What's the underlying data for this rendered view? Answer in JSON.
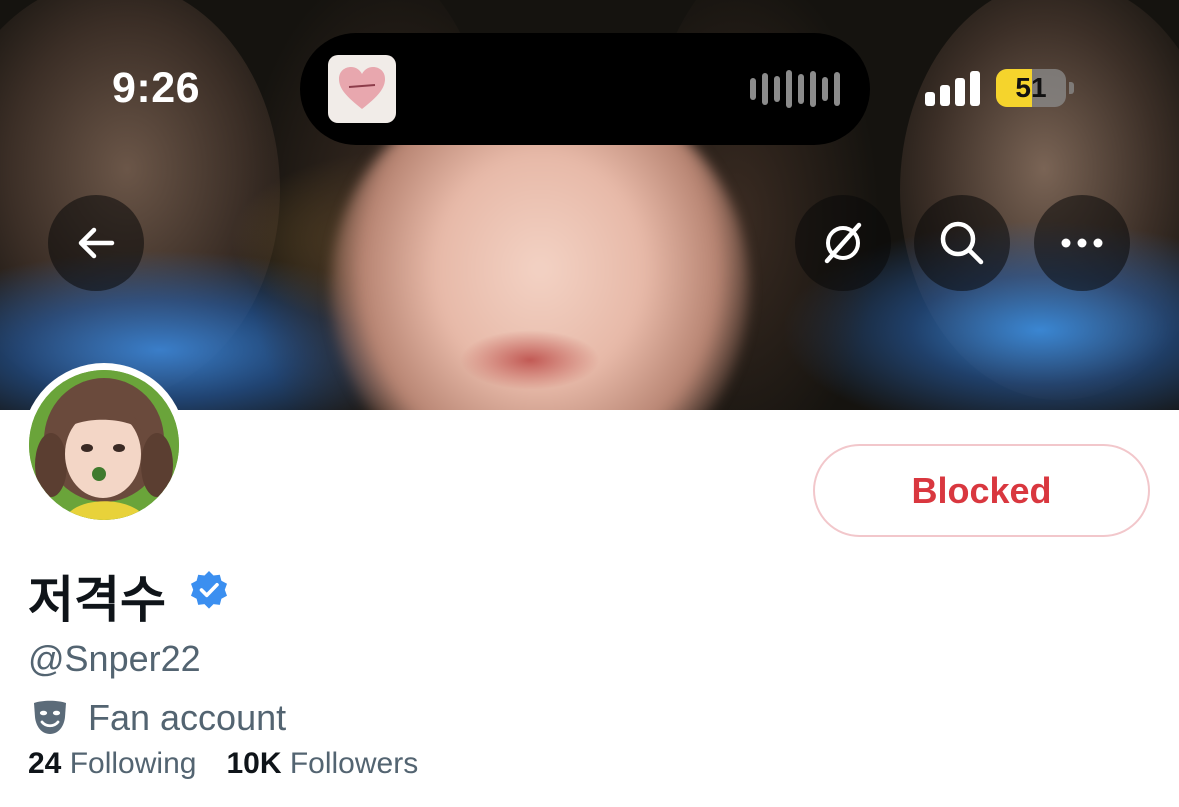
{
  "status_bar": {
    "time": "9:26",
    "battery_level": "51",
    "battery_fraction": 0.51,
    "signal_bars": 4,
    "accent_battery": "#f5d42c"
  },
  "dynamic_island": {
    "album_art": "heart-album-art",
    "wave_icon": "audio-waveform-icon"
  },
  "header_buttons": {
    "back": "arrow-left-icon",
    "grok": "grok-slash-circle-icon",
    "search": "search-icon",
    "more": "more-horizontal-icon"
  },
  "profile": {
    "display_name": "저격수",
    "verified": true,
    "verified_color": "#3b8ff0",
    "handle": "@Snper22",
    "category_icon": "theater-masks-icon",
    "category": "Fan account",
    "following_count": "24",
    "following_label": "Following",
    "followers_count": "10K",
    "followers_label": "Followers"
  },
  "action_button": {
    "label": "Blocked",
    "color": "#d9373f",
    "border_color": "#f2c7cb"
  }
}
